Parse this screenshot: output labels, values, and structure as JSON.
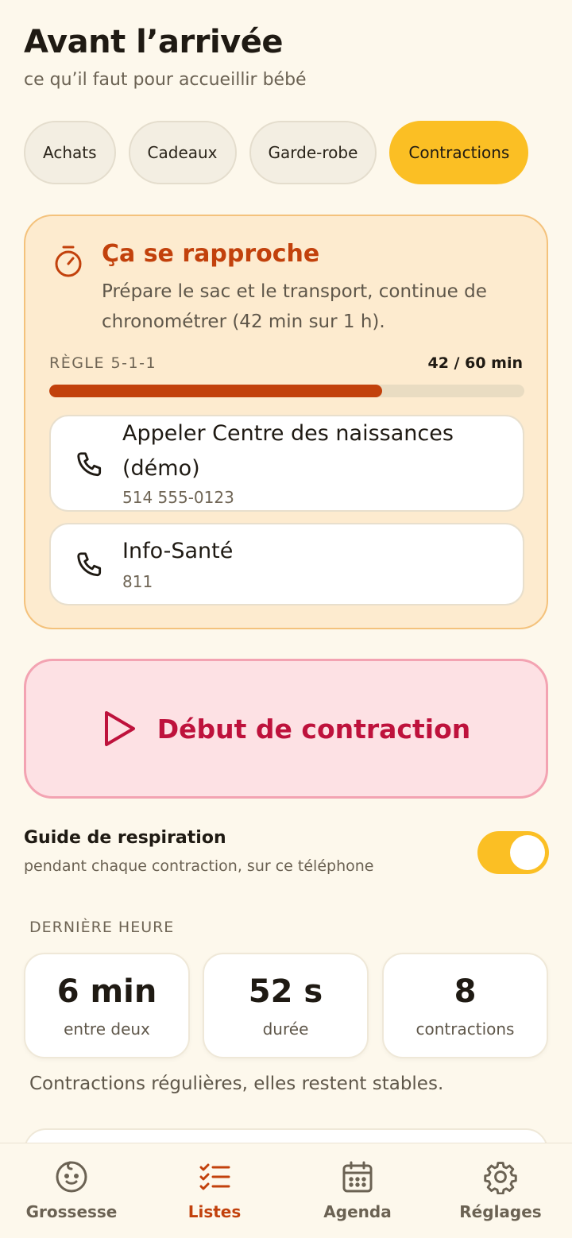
{
  "header": {
    "title": "Avant l’arrivée",
    "subtitle": "ce qu’il faut pour accueillir bébé"
  },
  "tabs": [
    {
      "label": "Achats",
      "active": false
    },
    {
      "label": "Cadeaux",
      "active": false
    },
    {
      "label": "Garde-robe",
      "active": false
    },
    {
      "label": "Contractions",
      "active": true
    }
  ],
  "alert": {
    "icon": "stopwatch-icon",
    "title": "Ça se rapproche",
    "body": "Prépare le sac et le transport, continue de chronométrer (42 min sur 1 h).",
    "rule_label": "RÈGLE 5-1-1",
    "rule_value": "42 / 60 min",
    "progress": 0.7,
    "calls": [
      {
        "icon": "phone-icon",
        "name": "Appeler Centre des naissances (démo)",
        "number": "514 555-0123"
      },
      {
        "icon": "phone-icon",
        "name": "Info-Santé",
        "number": "811"
      }
    ]
  },
  "start_button": {
    "icon": "play-icon",
    "label": "Début de contraction"
  },
  "breathing": {
    "title": "Guide de respiration",
    "subtitle": "pendant chaque contraction, sur ce téléphone",
    "enabled": true
  },
  "last_hour": {
    "label": "DERNIÈRE HEURE",
    "stats": [
      {
        "value": "6 min",
        "caption": "entre deux"
      },
      {
        "value": "52 s",
        "caption": "durée"
      },
      {
        "value": "8",
        "caption": "contractions"
      }
    ],
    "summary": "Contractions régulières, elles restent stables."
  },
  "bottom_nav": [
    {
      "icon": "baby-face-icon",
      "label": "Grossesse",
      "active": false
    },
    {
      "icon": "checklist-icon",
      "label": "Listes",
      "active": true
    },
    {
      "icon": "calendar-icon",
      "label": "Agenda",
      "active": false
    },
    {
      "icon": "gear-icon",
      "label": "Réglages",
      "active": false
    }
  ],
  "colors": {
    "background": "#fdf8ec",
    "accent_yellow": "#fbbf24",
    "alert_orange": "#c2410c",
    "start_red": "#be123c"
  }
}
